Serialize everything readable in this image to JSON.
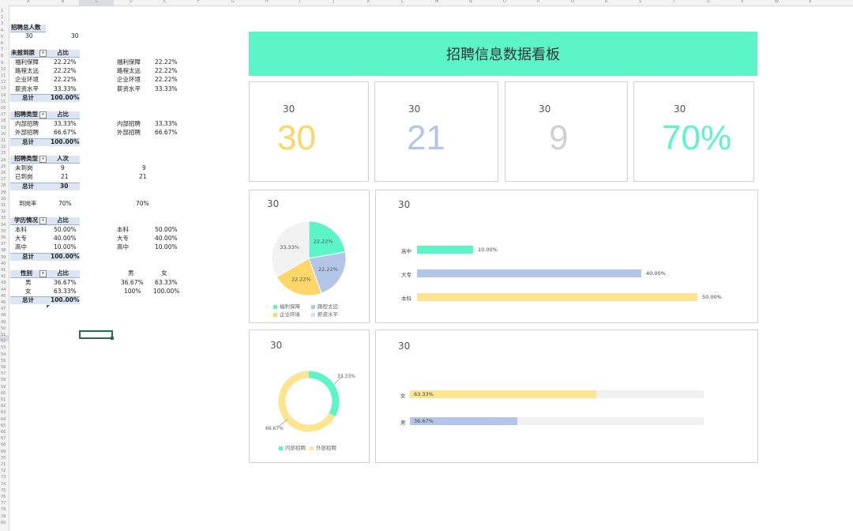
{
  "sheet": {
    "columns": [
      "A",
      "B",
      "C",
      "D",
      "E",
      "F",
      "G",
      "H",
      "I",
      "J",
      "K",
      "L",
      "M",
      "N",
      "O",
      "P",
      "Q",
      "R",
      "S",
      "T",
      "U",
      "V",
      "W",
      "X"
    ],
    "rows": [
      "1",
      "2",
      "3",
      "4",
      "5",
      "6",
      "7",
      "8",
      "9",
      "10",
      "11",
      "12",
      "13",
      "14",
      "15",
      "16",
      "17",
      "18",
      "19",
      "20",
      "21",
      "22",
      "23",
      "24",
      "25",
      "26",
      "27",
      "28",
      "29",
      "30",
      "31",
      "32",
      "33",
      "34",
      "35",
      "36",
      "37",
      "38",
      "39",
      "40",
      "41",
      "42",
      "43",
      "44",
      "45",
      "46",
      "47",
      "48",
      "49",
      "50",
      "51",
      "52",
      "53",
      "54",
      "55",
      "56",
      "57",
      "58",
      "59",
      "60",
      "61",
      "62",
      "63",
      "64",
      "65",
      "66",
      "67",
      "68",
      "69",
      "70",
      "71",
      "72",
      "73",
      "74",
      "75",
      "76",
      "77",
      "78",
      "79",
      "80",
      "81"
    ],
    "total_header": "招聘总人数",
    "total_a": "30",
    "total_b": "30",
    "unreported": {
      "h1": "未报到原",
      "h2": "占比",
      "rows": [
        {
          "name": "福利保障",
          "pct": "22.22%"
        },
        {
          "name": "路程太远",
          "pct": "22.22%"
        },
        {
          "name": "企业环境",
          "pct": "22.22%"
        },
        {
          "name": "薪资水平",
          "pct": "33.33%"
        }
      ],
      "total_label": "总计",
      "total": "100.00%",
      "side": [
        {
          "name": "福利保障",
          "pct": "22.22%"
        },
        {
          "name": "路程太远",
          "pct": "22.22%"
        },
        {
          "name": "企业环境",
          "pct": "22.22%"
        },
        {
          "name": "薪资水平",
          "pct": "33.33%"
        }
      ]
    },
    "rtype": {
      "h1": "招聘类型",
      "h2": "占比",
      "rows": [
        {
          "name": "内部招聘",
          "pct": "33.33%"
        },
        {
          "name": "外部招聘",
          "pct": "66.67%"
        }
      ],
      "total_label": "总计",
      "total": "100.00%",
      "side": [
        {
          "name": "内部招聘",
          "pct": "33.33%"
        },
        {
          "name": "外部招聘",
          "pct": "66.67%"
        }
      ]
    },
    "arrival": {
      "h1": "招聘类型",
      "h2": "人次",
      "rows": [
        {
          "name": "未到岗",
          "cnt": "9",
          "side": "9"
        },
        {
          "name": "已到岗",
          "cnt": "21",
          "side": "21"
        }
      ],
      "total_label": "总计",
      "total": "30"
    },
    "rate_label": "到岗率",
    "rate_a": "70%",
    "rate_b": "70%",
    "edu": {
      "h1": "学历情况",
      "h2": "占比",
      "rows": [
        {
          "name": "本科",
          "pct": "50.00%"
        },
        {
          "name": "大专",
          "pct": "40.00%"
        },
        {
          "name": "高中",
          "pct": "10.00%"
        }
      ],
      "total_label": "总计",
      "total": "100.00%",
      "side": [
        {
          "name": "本科",
          "pct": "50.00%"
        },
        {
          "name": "大专",
          "pct": "40.00%"
        },
        {
          "name": "高中",
          "pct": "10.00%"
        }
      ]
    },
    "gender": {
      "h1": "性别",
      "h2": "占比",
      "rows": [
        {
          "name": "男",
          "pct": "36.67%"
        },
        {
          "name": "女",
          "pct": "63.33%"
        }
      ],
      "total_label": "总计",
      "total": "100.00%",
      "side_h1": "男",
      "side_h2": "女",
      "side_r1a": "36.67%",
      "side_r1b": "63.33%",
      "side_r2a": "100%",
      "side_r2b": "100.00%"
    }
  },
  "dashboard": {
    "title": "招聘信息数据看板",
    "kpis": [
      {
        "small": "30",
        "big": "30",
        "color": "#fcd667"
      },
      {
        "small": "30",
        "big": "21",
        "color": "#b4c6e7"
      },
      {
        "small": "30",
        "big": "9",
        "color": "#d0d0d0"
      },
      {
        "small": "30",
        "big": "70%",
        "color": "#5cf5c8"
      }
    ],
    "pie_title": "30",
    "bar_title": "30",
    "donut_title": "30",
    "gender_title": "30"
  },
  "chart_data": [
    {
      "type": "pie",
      "categories": [
        "福利保障",
        "路程太远",
        "企业环境",
        "薪资水平"
      ],
      "values": [
        22.22,
        22.22,
        22.22,
        33.33
      ],
      "labels": [
        "22.22%",
        "22.22%",
        "22.22%",
        "33.33%"
      ],
      "colors": [
        "#5cf5c8",
        "#b4c6e7",
        "#fcd667",
        "#f2f2f2"
      ],
      "legend": "bottom"
    },
    {
      "type": "bar",
      "orientation": "horizontal",
      "categories": [
        "高中",
        "大专",
        "本科"
      ],
      "values": [
        10,
        40,
        50
      ],
      "labels": [
        "10.00%",
        "40.00%",
        "50.00%"
      ],
      "colors": [
        "#5cf5c8",
        "#b4c6e7",
        "#fde68f"
      ],
      "xlim": [
        0,
        55
      ]
    },
    {
      "type": "pie",
      "donut": true,
      "categories": [
        "内部招聘",
        "外部招聘"
      ],
      "values": [
        33.33,
        66.67
      ],
      "labels": [
        "33.33%",
        "66.67%"
      ],
      "colors": [
        "#5cf5c8",
        "#fde68f"
      ],
      "legend": "bottom"
    },
    {
      "type": "bar",
      "orientation": "horizontal",
      "stacked_background": true,
      "categories": [
        "女",
        "男"
      ],
      "values": [
        63.33,
        36.67
      ],
      "labels": [
        "63.33%",
        "36.67%"
      ],
      "colors": [
        "#fde68f",
        "#b4c6e7"
      ],
      "background": "#f0f0f0",
      "xlim": [
        0,
        100
      ]
    }
  ]
}
